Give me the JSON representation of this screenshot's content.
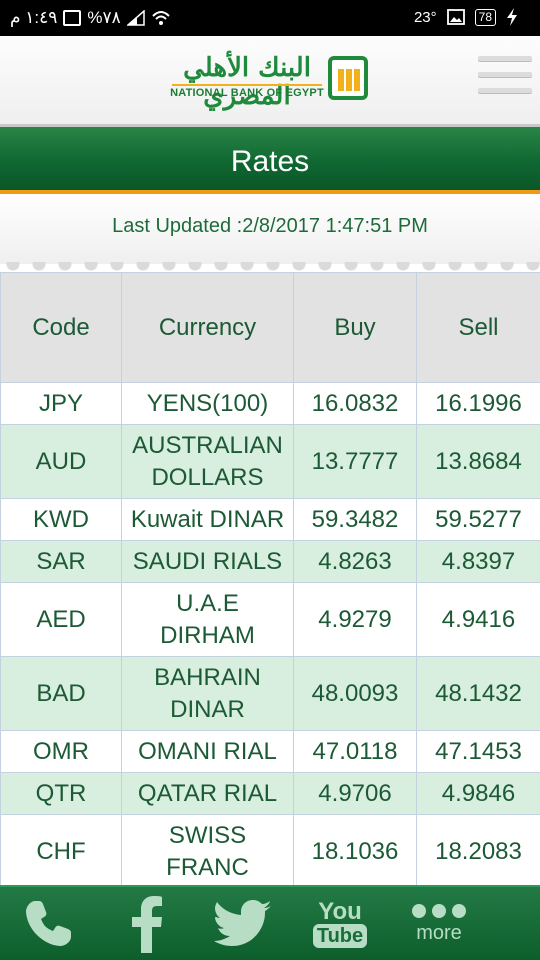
{
  "status_bar": {
    "time": "١:٤٩ م",
    "battery_percent": "%٧٨",
    "temperature": "23°",
    "battery_box": "78"
  },
  "header": {
    "logo_arabic": "البنك الأهلي المصري",
    "logo_english": "NATIONAL BANK OF EGYPT"
  },
  "page": {
    "title": "Rates",
    "last_updated": "Last Updated :2/8/2017 1:47:51 PM"
  },
  "table": {
    "columns": [
      "Code",
      "Currency",
      "Buy",
      "Sell"
    ],
    "rows": [
      {
        "code": "JPY",
        "currency_l1": "YENS(100)",
        "currency_l2": "",
        "buy": "16.0832",
        "sell": "16.1996"
      },
      {
        "code": "AUD",
        "currency_l1": "AUSTRALIAN",
        "currency_l2": "DOLLARS",
        "buy": "13.7777",
        "sell": "13.8684"
      },
      {
        "code": "KWD",
        "currency_l1": "Kuwait DINAR",
        "currency_l2": "",
        "buy": "59.3482",
        "sell": "59.5277"
      },
      {
        "code": "SAR",
        "currency_l1": "SAUDI RIALS",
        "currency_l2": "",
        "buy": "4.8263",
        "sell": "4.8397"
      },
      {
        "code": "AED",
        "currency_l1": "U.A.E",
        "currency_l2": "DIRHAM",
        "buy": "4.9279",
        "sell": "4.9416"
      },
      {
        "code": "BAD",
        "currency_l1": "BAHRAIN",
        "currency_l2": "DINAR",
        "buy": "48.0093",
        "sell": "48.1432"
      },
      {
        "code": "OMR",
        "currency_l1": "OMANI RIAL",
        "currency_l2": "",
        "buy": "47.0118",
        "sell": "47.1453"
      },
      {
        "code": "QTR",
        "currency_l1": "QATAR RIAL",
        "currency_l2": "",
        "buy": "4.9706",
        "sell": "4.9846"
      },
      {
        "code": "CHF",
        "currency_l1": "SWISS",
        "currency_l2": "FRANC",
        "buy": "18.1036",
        "sell": "18.2083"
      }
    ]
  },
  "bottom_nav": {
    "youtube_top": "You",
    "youtube_bottom": "Tube",
    "more_label": "more"
  },
  "colors": {
    "brand_green": "#106832",
    "accent_orange": "#f09b16",
    "row_stripe": "#d8eedf",
    "text_green": "#1c5a35"
  }
}
